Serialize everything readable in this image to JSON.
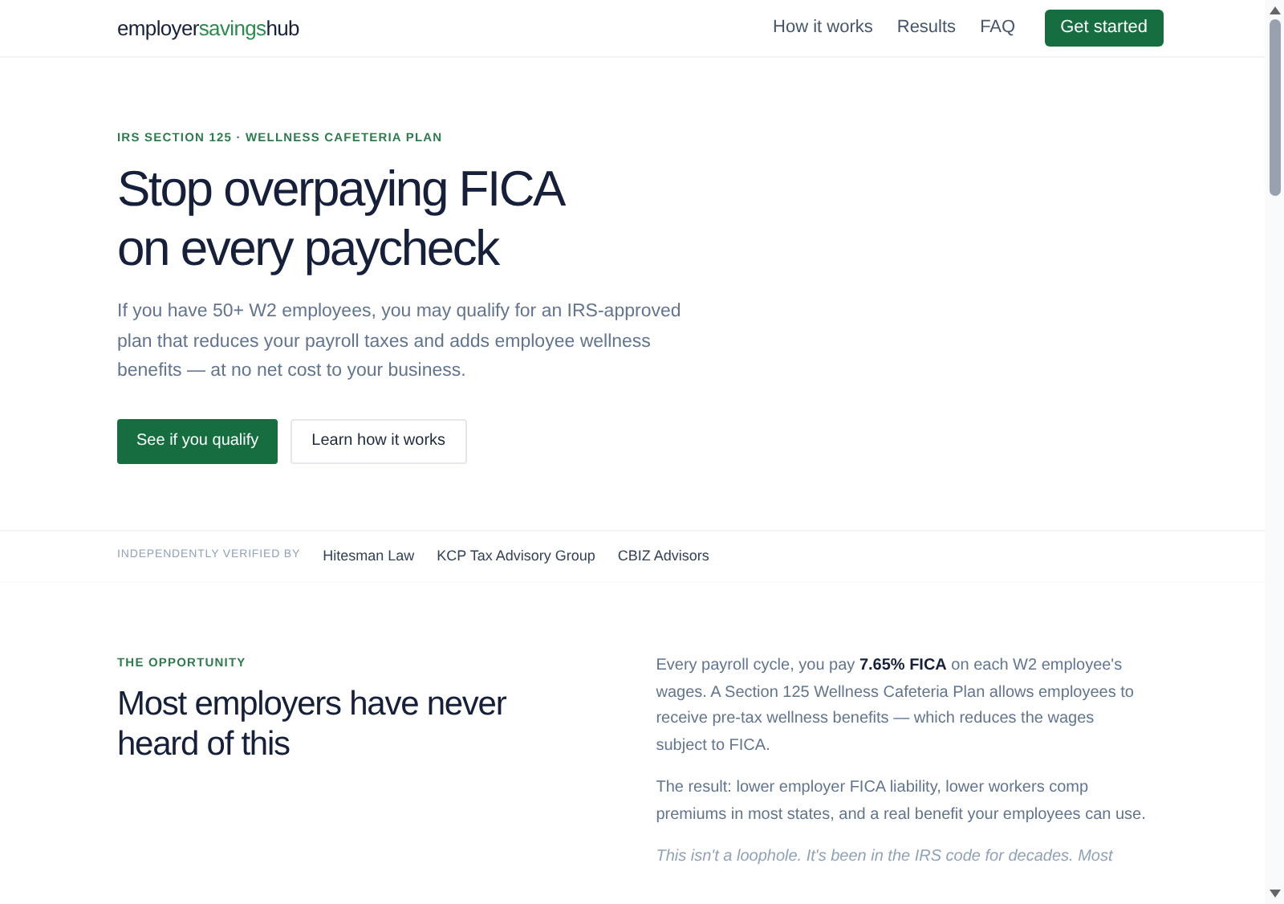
{
  "header": {
    "logo": [
      {
        "text": "employer",
        "accent": false
      },
      {
        "text": "savings",
        "accent": true
      },
      {
        "text": "hub",
        "accent": false
      }
    ],
    "nav": [
      "How it works",
      "Results",
      "FAQ"
    ],
    "cta": "Get started"
  },
  "hero": {
    "eyebrow": "IRS SECTION 125 · WELLNESS CAFETERIA PLAN",
    "title_lines": [
      "Stop overpaying FICA",
      "on every paycheck"
    ],
    "intro": "If you have 50+ W2 employees, you may qualify for an IRS-approved plan that reduces your payroll taxes and adds employee wellness benefits — at no net cost to your business.",
    "buttons": [
      {
        "label": "See if you qualify",
        "kind": "primary"
      },
      {
        "label": "Learn how it works",
        "kind": "secondary"
      }
    ]
  },
  "verified": {
    "label": "INDEPENDENTLY VERIFIED BY",
    "partners": [
      "Hitesman Law",
      "KCP Tax Advisory Group",
      "CBIZ Advisors"
    ]
  },
  "opportunity": {
    "eyebrow": "THE OPPORTUNITY",
    "title_lines": [
      "Most employers have never",
      "heard of this"
    ],
    "paragraphs": [
      {
        "text": "Every payroll cycle, you pay **7.65% FICA** on each W2 employee's wages. A Section 125 Wellness Cafeteria Plan allows employees to receive pre-tax wellness benefits — which reduces the wages subject to FICA.",
        "kind": "body"
      },
      {
        "text": "The result: lower employer FICA liability, lower workers comp premiums in most states, and a real benefit your employees can use.",
        "kind": "body"
      },
      {
        "text": "This isn't a loophole. It's been in the IRS code for decades. Most",
        "kind": "note"
      }
    ]
  }
}
